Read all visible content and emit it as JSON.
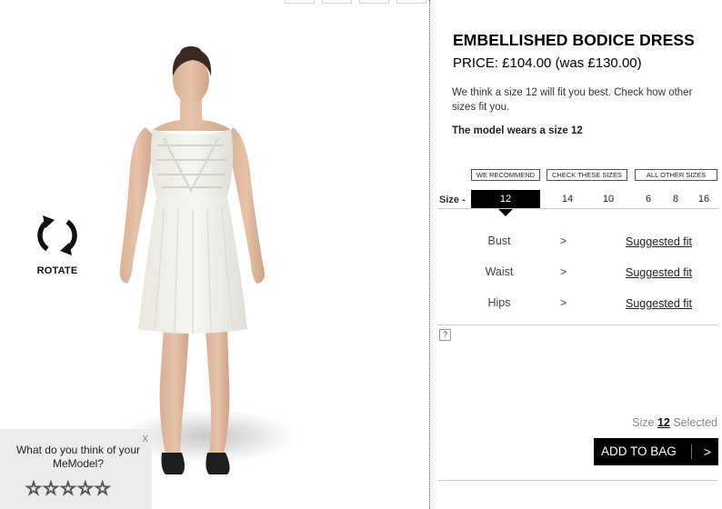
{
  "product": {
    "title": "EMBELLISHED BODICE DRESS",
    "price": "PRICE: £104.00 (was £130.00)"
  },
  "fit": {
    "advice": "We think a size 12 will fit you best. Check how other sizes fit you.",
    "model_note": "The model wears a size 12"
  },
  "size_groups": {
    "recommend": "WE RECOMMEND",
    "check": "CHECK THESE SIZES",
    "other": "ALL OTHER SIZES"
  },
  "sizes": {
    "header": "Size -",
    "options": [
      "12",
      "14",
      "10",
      "6",
      "8",
      "16"
    ],
    "selected": "12"
  },
  "measurements": [
    {
      "label": "Bust",
      "arrow": ">",
      "link": "Suggested fit"
    },
    {
      "label": "Waist",
      "arrow": ">",
      "link": "Suggested fit"
    },
    {
      "label": "Hips",
      "arrow": ">",
      "link": "Suggested fit"
    }
  ],
  "help": "?",
  "selection": {
    "prefix": "Size",
    "size": "12",
    "suffix": "Selected"
  },
  "cart": {
    "button": "ADD TO BAG",
    "chevron": ">"
  },
  "viewer": {
    "rotate_label": "ROTATE",
    "rotate_icon": "rotate-arrows-icon"
  },
  "rating": {
    "close": "x",
    "question": "What do you think of your MeModel?",
    "stars": [
      "☆",
      "☆",
      "☆",
      "☆",
      "☆"
    ],
    "value": 0,
    "max": 5
  },
  "colors": {
    "accent": "#000000",
    "dress": "#f1efe9"
  }
}
